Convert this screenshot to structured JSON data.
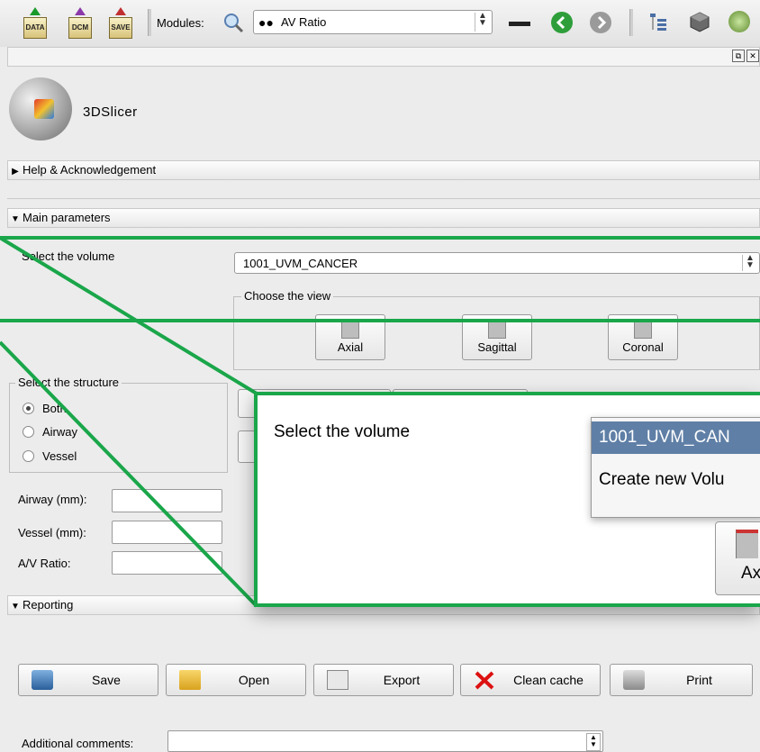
{
  "toolbar": {
    "buttons": [
      {
        "icon": "data-icon",
        "label": "DATA"
      },
      {
        "icon": "dcm-icon",
        "label": "DCM"
      },
      {
        "icon": "save-icon",
        "label": "SAVE"
      }
    ],
    "modules_label": "Modules:",
    "module_selected": "AV Ratio",
    "icons": [
      "search-icon",
      "layout-icon",
      "back-icon",
      "forward-icon",
      "tree-icon",
      "cube-icon",
      "sphere-icon"
    ]
  },
  "logo_text": "3DSlicer",
  "panels": {
    "help": "Help & Acknowledgement",
    "main": "Main parameters",
    "reporting": "Reporting"
  },
  "volume": {
    "label": "Select the volume",
    "value": "1001_UVM_CANCER"
  },
  "view": {
    "legend": "Choose the view",
    "buttons": [
      "Axial",
      "Sagittal",
      "Coronal"
    ]
  },
  "structure": {
    "legend": "Select the structure",
    "options": [
      "Both",
      "Airway",
      "Vessel"
    ],
    "selected": "Both"
  },
  "measurements": {
    "airway": "Airway (mm):",
    "vessel": "Vessel (mm):",
    "ratio": "A/V Ratio:"
  },
  "zoom": {
    "label": "Select the volume",
    "dropdown_selected": "1001_UVM_CAN",
    "dropdown_option": "Create new Volu",
    "button": "Ax"
  },
  "actions": [
    "Save",
    "Open",
    "Export",
    "Clean cache",
    "Print"
  ],
  "comments_label": "Additional comments:",
  "colors": {
    "highlight": "#1aa64a",
    "selection": "#5f7fa6"
  }
}
